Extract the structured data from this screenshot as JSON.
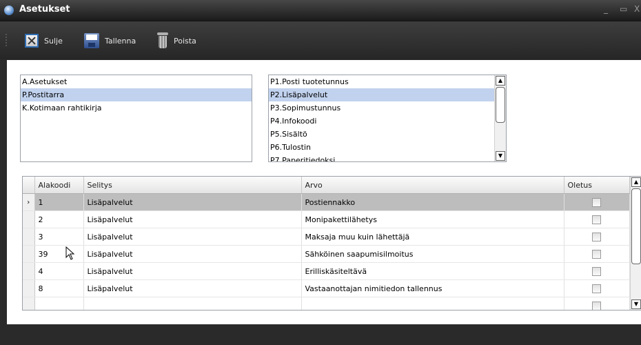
{
  "window": {
    "title": "Asetukset",
    "minimize": "_",
    "maximize": "▭",
    "close": "X"
  },
  "toolbar": {
    "close_label": "Sulje",
    "save_label": "Tallenna",
    "delete_label": "Poista"
  },
  "categories": [
    {
      "label": "A.Asetukset",
      "selected": false
    },
    {
      "label": "P.Postitarra",
      "selected": true
    },
    {
      "label": "K.Kotimaan rahtikirja",
      "selected": false
    }
  ],
  "subcategories": [
    {
      "label": "P1.Posti tuotetunnus",
      "selected": false
    },
    {
      "label": "P2.Lisäpalvelut",
      "selected": true
    },
    {
      "label": "P3.Sopimustunnus",
      "selected": false
    },
    {
      "label": "P4.Infokoodi",
      "selected": false
    },
    {
      "label": "P5.Sisältö",
      "selected": false
    },
    {
      "label": "P6.Tulostin",
      "selected": false
    },
    {
      "label": "P7.Paperitiedoksi",
      "selected": false
    }
  ],
  "grid": {
    "columns": [
      "Alakoodi",
      "Selitys",
      "Arvo",
      "Oletus"
    ],
    "current_row_marker": "›",
    "rows": [
      {
        "code": "1",
        "desc": "Lisäpalvelut",
        "value": "Postiennakko",
        "default": false,
        "current": true
      },
      {
        "code": "2",
        "desc": "Lisäpalvelut",
        "value": "Monipakettilähetys",
        "default": false,
        "current": false
      },
      {
        "code": "3",
        "desc": "Lisäpalvelut",
        "value": "Maksaja muu kuin lähettäjä",
        "default": false,
        "current": false
      },
      {
        "code": "39",
        "desc": "Lisäpalvelut",
        "value": "Sähköinen saapumisilmoitus",
        "default": false,
        "current": false
      },
      {
        "code": "4",
        "desc": "Lisäpalvelut",
        "value": "Erilliskäsiteltävä",
        "default": false,
        "current": false
      },
      {
        "code": "8",
        "desc": "Lisäpalvelut",
        "value": "Vastaanottajan nimitiedon tallennus",
        "default": false,
        "current": false
      },
      {
        "code": "",
        "desc": "",
        "value": "",
        "default": false,
        "current": false
      }
    ]
  }
}
